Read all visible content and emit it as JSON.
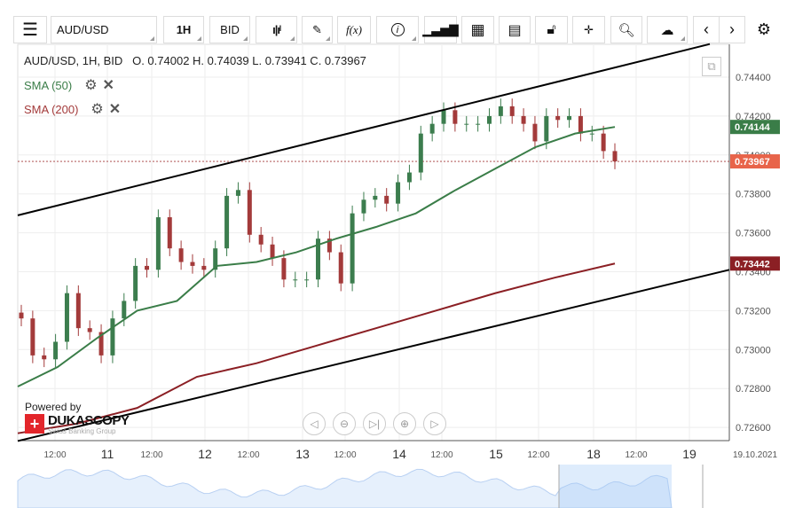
{
  "toolbar": {
    "menu": "menu-icon",
    "instrument": "AUD/USD",
    "period": "1H",
    "side": "BID",
    "fx": "f(x)"
  },
  "legend": {
    "header": "AUD/USD, 1H, BID",
    "ohlc": "O. 0.74002 H. 0.74039 L. 0.73941 C. 0.73967",
    "sma50": "SMA (50)",
    "sma200": "SMA (200)"
  },
  "branding": {
    "powered": "Powered by",
    "logo": "DUKASCOPY",
    "sub": "Swiss Banking Group"
  },
  "colors": {
    "up": "#3c7d4e",
    "down": "#a33a3a",
    "sma50": "#3a7d48",
    "sma200": "#8b1f24",
    "trend": "#000000",
    "last": "#e8644a"
  },
  "chart_data": {
    "type": "candlestick",
    "ylim": [
      0.7253,
      0.7457
    ],
    "yticks": [
      "0.74400",
      "0.74200",
      "0.74000",
      "0.73800",
      "0.73600",
      "0.73400",
      "0.73200",
      "0.73000",
      "0.72800",
      "0.72600"
    ],
    "xticks": [
      "12:00",
      "11",
      "12:00",
      "12",
      "12:00",
      "13",
      "12:00",
      "14",
      "12:00",
      "15",
      "12:00",
      "18",
      "12:00",
      "19",
      "19.10.2021"
    ],
    "closes": [
      0.7316,
      0.7297,
      0.7295,
      0.7304,
      0.7329,
      0.7311,
      0.7309,
      0.7297,
      0.7316,
      0.7325,
      0.7343,
      0.7341,
      0.7368,
      0.7352,
      0.7345,
      0.7343,
      0.7341,
      0.7352,
      0.7379,
      0.7382,
      0.7359,
      0.7354,
      0.7347,
      0.7336,
      0.7336,
      0.7336,
      0.7357,
      0.735,
      0.7334,
      0.737,
      0.7377,
      0.7379,
      0.7375,
      0.7386,
      0.7391,
      0.7411,
      0.7416,
      0.7423,
      0.7416,
      0.7416,
      0.7416,
      0.742,
      0.7425,
      0.742,
      0.7416,
      0.7407,
      0.742,
      0.7418,
      0.742,
      0.7411,
      0.7411,
      0.7402,
      0.73967
    ],
    "sma50": [
      0.7281,
      0.7291,
      0.7306,
      0.732,
      0.7325,
      0.7343,
      0.7345,
      0.735,
      0.7357,
      0.7363,
      0.737,
      0.7382,
      0.7393,
      0.7404,
      0.7411,
      0.74144
    ],
    "sma200": [
      0.7257,
      0.7262,
      0.727,
      0.7286,
      0.7293,
      0.7302,
      0.7311,
      0.732,
      0.7329,
      0.7337,
      0.73442
    ],
    "trend_upper": [
      0.7369,
      0.7457
    ],
    "trend_lower": [
      0.7253,
      0.7341
    ],
    "last_labels": {
      "sma50": "0.74144",
      "close": "0.73967",
      "sma200": "0.73442"
    },
    "dashed_level": 0.73967
  }
}
